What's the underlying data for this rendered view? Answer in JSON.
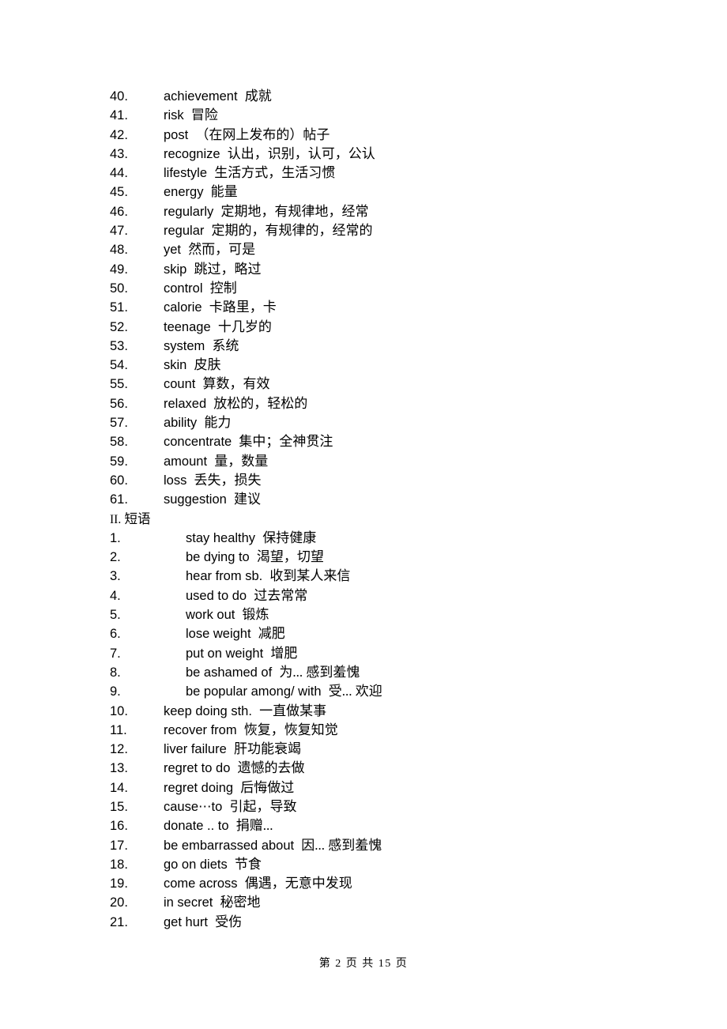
{
  "document": {
    "page_footer": "第 2 页 共 15 页"
  },
  "vocabulary": {
    "items": [
      {
        "num": "40.",
        "en": "achievement",
        "cn": "成就"
      },
      {
        "num": "41.",
        "en": "risk",
        "cn": "冒险"
      },
      {
        "num": "42.",
        "en": "post",
        "cn": "（在网上发布的）帖子"
      },
      {
        "num": "43.",
        "en": "recognize",
        "cn": "认出，识别，认可，公认"
      },
      {
        "num": "44.",
        "en": "lifestyle",
        "cn": "生活方式，生活习惯"
      },
      {
        "num": "45.",
        "en": "energy",
        "cn": "能量"
      },
      {
        "num": "46.",
        "en": "regularly",
        "cn": "定期地，有规律地，经常"
      },
      {
        "num": "47.",
        "en": "regular",
        "cn": "定期的，有规律的，经常的"
      },
      {
        "num": "48.",
        "en": "yet",
        "cn": "然而，可是"
      },
      {
        "num": "49.",
        "en": "skip",
        "cn": "跳过，略过"
      },
      {
        "num": "50.",
        "en": "control",
        "cn": "控制"
      },
      {
        "num": "51.",
        "en": "calorie",
        "cn": "卡路里，卡"
      },
      {
        "num": "52.",
        "en": "teenage",
        "cn": "十几岁的"
      },
      {
        "num": "53.",
        "en": "system",
        "cn": "系统"
      },
      {
        "num": "54.",
        "en": "skin",
        "cn": "皮肤"
      },
      {
        "num": "55.",
        "en": "count",
        "cn": "算数，有效"
      },
      {
        "num": "56.",
        "en": "relaxed",
        "cn": "放松的，轻松的"
      },
      {
        "num": "57.",
        "en": "ability",
        "cn": "能力"
      },
      {
        "num": "58.",
        "en": "concentrate",
        "cn": "集中；全神贯注"
      },
      {
        "num": "59.",
        "en": "amount",
        "cn": "量，数量"
      },
      {
        "num": "60.",
        "en": "loss",
        "cn": "丢失，损失"
      },
      {
        "num": "61.",
        "en": "suggestion",
        "cn": "建议"
      }
    ]
  },
  "phrases_section": {
    "heading_num": "II.",
    "heading_label": "短语",
    "items": [
      {
        "num": "1.",
        "en": "stay healthy",
        "cn": "保持健康",
        "indent": true
      },
      {
        "num": "2.",
        "en": "be dying to",
        "cn": "渴望，切望",
        "indent": true
      },
      {
        "num": "3.",
        "en": "hear from sb.",
        "cn": "收到某人来信",
        "indent": true
      },
      {
        "num": "4.",
        "en": "used to do",
        "cn": "过去常常",
        "indent": true
      },
      {
        "num": "5.",
        "en": "work out",
        "cn": "锻炼",
        "indent": true
      },
      {
        "num": "6.",
        "en": "lose weight",
        "cn": "减肥",
        "indent": true
      },
      {
        "num": "7.",
        "en": "put on weight",
        "cn": "增肥",
        "indent": true
      },
      {
        "num": "8.",
        "en": "be ashamed of",
        "cn": "为... 感到羞愧",
        "indent": true
      },
      {
        "num": "9.",
        "en": "be popular among/ with",
        "cn": "受... 欢迎",
        "indent": true
      },
      {
        "num": "10.",
        "en": "keep doing sth.",
        "cn": "一直做某事",
        "indent": false
      },
      {
        "num": "11.",
        "en": "recover from",
        "cn": "恢复，恢复知觉",
        "indent": false
      },
      {
        "num": "12.",
        "en": "liver failure",
        "cn": "肝功能衰竭",
        "indent": false
      },
      {
        "num": "13.",
        "en": "regret to do",
        "cn": "遗憾的去做",
        "indent": false
      },
      {
        "num": "14.",
        "en": "regret doing",
        "cn": "后悔做过",
        "indent": false
      },
      {
        "num": "15.",
        "en": "cause⋯to",
        "cn": "引起，导致",
        "indent": false
      },
      {
        "num": "16.",
        "en": "donate .. to",
        "cn": "捐赠...",
        "indent": false
      },
      {
        "num": "17.",
        "en": "be embarrassed about",
        "cn": "因... 感到羞愧",
        "indent": false
      },
      {
        "num": "18.",
        "en": "go on diets",
        "cn": "节食",
        "indent": false
      },
      {
        "num": "19.",
        "en": "come across",
        "cn": "偶遇，无意中发现",
        "indent": false
      },
      {
        "num": "20.",
        "en": "in secret",
        "cn": "秘密地",
        "indent": false
      },
      {
        "num": "21.",
        "en": "get hurt",
        "cn": "受伤",
        "indent": false
      }
    ]
  }
}
